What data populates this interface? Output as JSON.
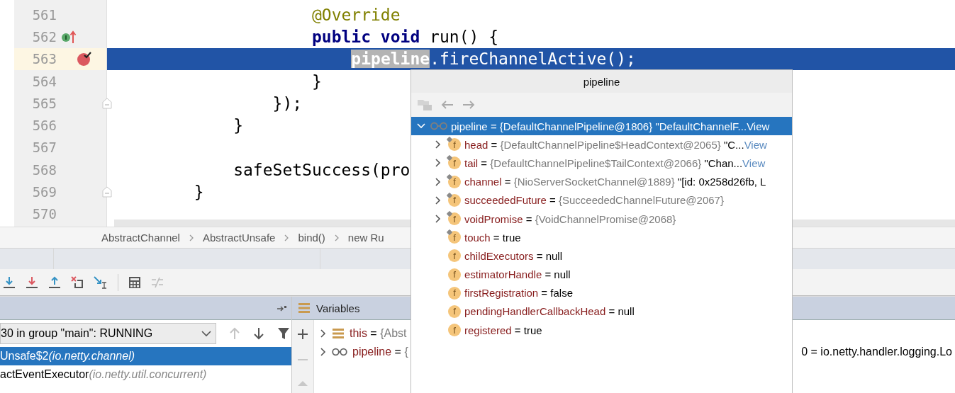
{
  "editor": {
    "lines": [
      {
        "number": "561",
        "selected": false,
        "kind": "plain",
        "tokens": [
          {
            "kind": "annotation",
            "text": "                    @Override"
          }
        ]
      },
      {
        "number": "562",
        "selected": false,
        "kind": "implements",
        "tokens": [
          {
            "kind": "keyword",
            "text": "                    public void"
          },
          {
            "kind": "plain",
            "text": " run() {"
          }
        ]
      },
      {
        "number": "563",
        "selected": true,
        "kind": "breakpoint",
        "tokens": [
          {
            "kind": "highlight",
            "text": "                        pipeline"
          },
          {
            "kind": "plain",
            "text": ".fireChannelActive();"
          }
        ]
      },
      {
        "number": "564",
        "selected": false,
        "kind": "plain",
        "tokens": [
          {
            "kind": "plain",
            "text": "                    }"
          }
        ]
      },
      {
        "number": "565",
        "selected": false,
        "kind": "fold",
        "tokens": [
          {
            "kind": "plain",
            "text": "                });"
          }
        ]
      },
      {
        "number": "566",
        "selected": false,
        "kind": "plain",
        "tokens": [
          {
            "kind": "plain",
            "text": "            }"
          }
        ]
      },
      {
        "number": "567",
        "selected": false,
        "kind": "plain"
      },
      {
        "number": "568",
        "selected": false,
        "kind": "plain",
        "tokens": [
          {
            "kind": "plain",
            "text": "            safeSetSuccess(pro"
          }
        ]
      },
      {
        "number": "569",
        "selected": false,
        "kind": "fold",
        "tokens": [
          {
            "kind": "plain",
            "text": "        }"
          }
        ]
      },
      {
        "number": "570",
        "selected": false,
        "kind": "plain"
      }
    ]
  },
  "breadcrumbs": [
    "AbstractChannel",
    "AbstractUnsafe",
    "bind()",
    "new Ru"
  ],
  "debug_toolbar": [
    {
      "kind": "step-over",
      "disabled": false
    },
    {
      "kind": "force-step-into",
      "disabled": false
    },
    {
      "kind": "step-out",
      "disabled": false
    },
    {
      "kind": "drop-frame",
      "disabled": false
    },
    {
      "kind": "run-to-cursor",
      "disabled": false
    },
    {
      "kind": "separator"
    },
    {
      "kind": "evaluate",
      "disabled": false
    },
    {
      "kind": "trace",
      "disabled": true
    }
  ],
  "frames": {
    "thread": "30 in group \"main\": RUNNING",
    "nav": [
      {
        "kind": "up",
        "disabled": true
      },
      {
        "kind": "down",
        "disabled": false
      },
      {
        "kind": "filter",
        "disabled": false
      }
    ],
    "items": [
      {
        "method": "Unsafe$2",
        "package": "(io.netty.channel)",
        "selected": true
      },
      {
        "method": "actEventExecutor",
        "package": "(io.netty.util.concurrent)",
        "selected": false
      }
    ]
  },
  "variables": {
    "title": "Variables",
    "rows": [
      {
        "kind": "object",
        "name": "this",
        "assign": "=",
        "type": "{Abst",
        "expanded": false
      },
      {
        "kind": "watch",
        "name": "pipeline",
        "assign": "=",
        "type": "{",
        "expanded": false,
        "trailing": "0 = io.netty.handler.logging.Lo"
      }
    ]
  },
  "popup": {
    "title": "pipeline",
    "rows": [
      {
        "kind": "watch",
        "name": "pipeline",
        "assign": "=",
        "type": "{DefaultChannelPipeline@1806}",
        "value": "\"DefaultChannelF...",
        "link": "View",
        "has_children": true,
        "expanded": true,
        "selected": true,
        "children": [
          {
            "kind": "field",
            "glyph": "f",
            "final": true,
            "name": "head",
            "assign": "=",
            "type": "{DefaultChannelPipeline$HeadContext@2065}",
            "value": "\"C...",
            "link": "View",
            "has_children": true,
            "expanded": false,
            "selected": false
          },
          {
            "kind": "field",
            "glyph": "f",
            "final": true,
            "name": "tail",
            "assign": "=",
            "type": "{DefaultChannelPipeline$TailContext@2066}",
            "value": "\"Chan...",
            "link": "View",
            "has_children": true,
            "expanded": false,
            "selected": false
          },
          {
            "kind": "field",
            "glyph": "f",
            "final": true,
            "name": "channel",
            "assign": "=",
            "type": "{NioServerSocketChannel@1889}",
            "value": "\"[id: 0x258d26fb, L",
            "has_children": true,
            "expanded": false,
            "selected": false
          },
          {
            "kind": "field",
            "glyph": "f",
            "final": true,
            "name": "succeededFuture",
            "assign": "=",
            "type": "{SucceededChannelFuture@2067}",
            "has_children": true,
            "expanded": false,
            "selected": false
          },
          {
            "kind": "field",
            "glyph": "f",
            "final": true,
            "name": "voidPromise",
            "assign": "=",
            "type": "{VoidChannelPromise@2068}",
            "has_children": true,
            "expanded": false,
            "selected": false
          },
          {
            "kind": "field",
            "glyph": "f",
            "final": true,
            "name": "touch",
            "assign": "=",
            "value": "true",
            "selected": false
          },
          {
            "kind": "field",
            "glyph": "f",
            "final": false,
            "name": "childExecutors",
            "assign": "=",
            "value": "null",
            "selected": false
          },
          {
            "kind": "field",
            "glyph": "f",
            "final": false,
            "name": "estimatorHandle",
            "assign": "=",
            "value": "null",
            "selected": false
          },
          {
            "kind": "field",
            "glyph": "f",
            "final": false,
            "name": "firstRegistration",
            "assign": "=",
            "value": "false",
            "selected": false
          },
          {
            "kind": "field",
            "glyph": "f",
            "final": false,
            "name": "pendingHandlerCallbackHead",
            "assign": "=",
            "value": "null",
            "selected": false
          },
          {
            "kind": "field",
            "glyph": "f",
            "final": false,
            "name": "registered",
            "assign": "=",
            "value": "true",
            "selected": false
          }
        ]
      }
    ]
  }
}
